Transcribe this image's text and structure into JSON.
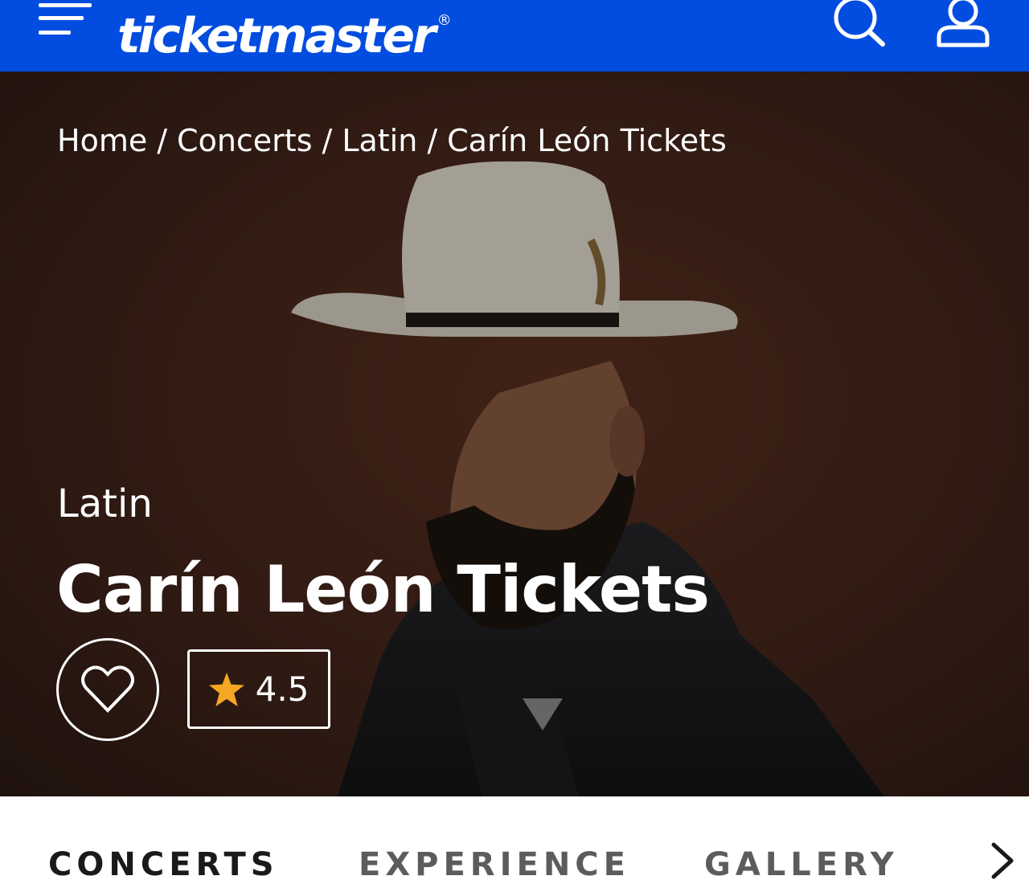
{
  "header": {
    "logo_text": "ticketmaster",
    "logo_registered": "®",
    "icons": [
      "menu-icon",
      "search-icon",
      "user-icon"
    ],
    "background_color": "#024ddf"
  },
  "hero": {
    "breadcrumb": [
      {
        "label": "Home"
      },
      {
        "label": "Concerts"
      },
      {
        "label": "Latin"
      },
      {
        "label": "Carín León Tickets"
      }
    ],
    "breadcrumb_separator": "/",
    "genre": "Latin",
    "title": "Carín León Tickets",
    "rating": "4.5",
    "rating_star_color": "#f5a623"
  },
  "tabs": [
    {
      "label": "CONCERTS",
      "active": true
    },
    {
      "label": "EXPERIENCE",
      "active": false
    },
    {
      "label": "GALLERY",
      "active": false
    }
  ]
}
